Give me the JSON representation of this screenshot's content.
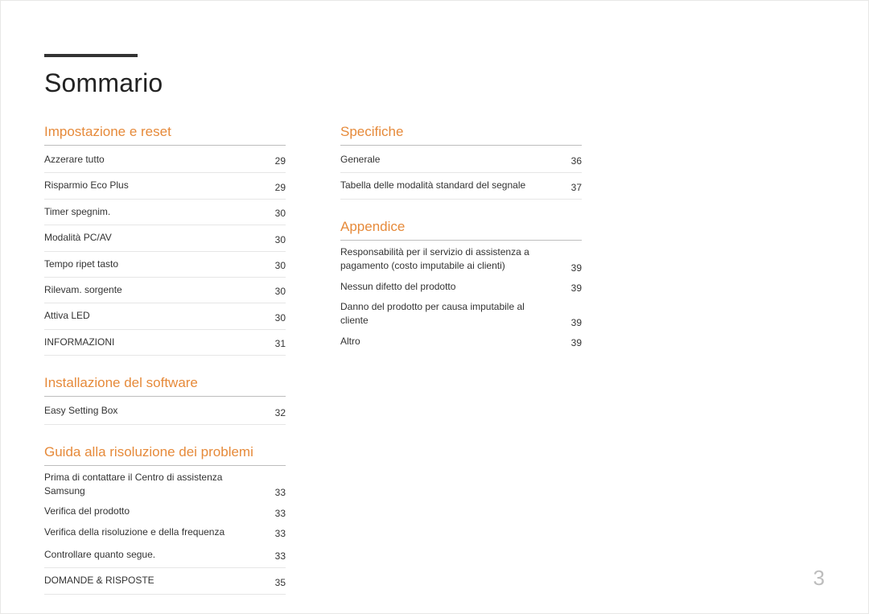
{
  "title": "Sommario",
  "page_number": "3",
  "left_column": [
    {
      "id": "impostazione",
      "title": "Impostazione e reset",
      "entries": [
        {
          "label": "Azzerare tutto",
          "page": "29",
          "border": true
        },
        {
          "label": "Risparmio Eco Plus",
          "page": "29",
          "border": true
        },
        {
          "label": "Timer spegnim.",
          "page": "30",
          "border": true
        },
        {
          "label": "Modalità PC/AV",
          "page": "30",
          "border": true
        },
        {
          "label": "Tempo ripet tasto",
          "page": "30",
          "border": true
        },
        {
          "label": "Rilevam. sorgente",
          "page": "30",
          "border": true
        },
        {
          "label": "Attiva LED",
          "page": "30",
          "border": true
        },
        {
          "label": "INFORMAZIONI",
          "page": "31",
          "border": true
        }
      ]
    },
    {
      "id": "installazione",
      "title": "Installazione del software",
      "entries": [
        {
          "label": "Easy Setting Box",
          "page": "32",
          "border": true
        }
      ]
    },
    {
      "id": "guida",
      "title": "Guida alla risoluzione dei problemi",
      "entries": [
        {
          "label": "Prima di contattare il Centro di assistenza Samsung",
          "page": "33",
          "border": false
        },
        {
          "label": "Verifica del prodotto",
          "page": "33",
          "border": false
        },
        {
          "label": "Verifica della risoluzione e della frequenza",
          "page": "33",
          "border": false
        },
        {
          "label": "Controllare quanto segue.",
          "page": "33",
          "border": true
        },
        {
          "label": "DOMANDE & RISPOSTE",
          "page": "35",
          "border": true
        }
      ]
    }
  ],
  "right_column": [
    {
      "id": "specifiche",
      "title": "Specifiche",
      "entries": [
        {
          "label": "Generale",
          "page": "36",
          "border": true
        },
        {
          "label": "Tabella delle modalità standard del segnale",
          "page": "37",
          "border": true
        }
      ]
    },
    {
      "id": "appendice",
      "title": "Appendice",
      "entries": [
        {
          "label": "Responsabilità per il servizio di assistenza a pagamento (costo imputabile ai clienti)",
          "page": "39",
          "border": false
        },
        {
          "label": "Nessun difetto del prodotto",
          "page": "39",
          "border": false
        },
        {
          "label": "Danno del prodotto per causa imputabile al cliente",
          "page": "39",
          "border": false
        },
        {
          "label": "Altro",
          "page": "39",
          "border": false
        }
      ]
    }
  ]
}
